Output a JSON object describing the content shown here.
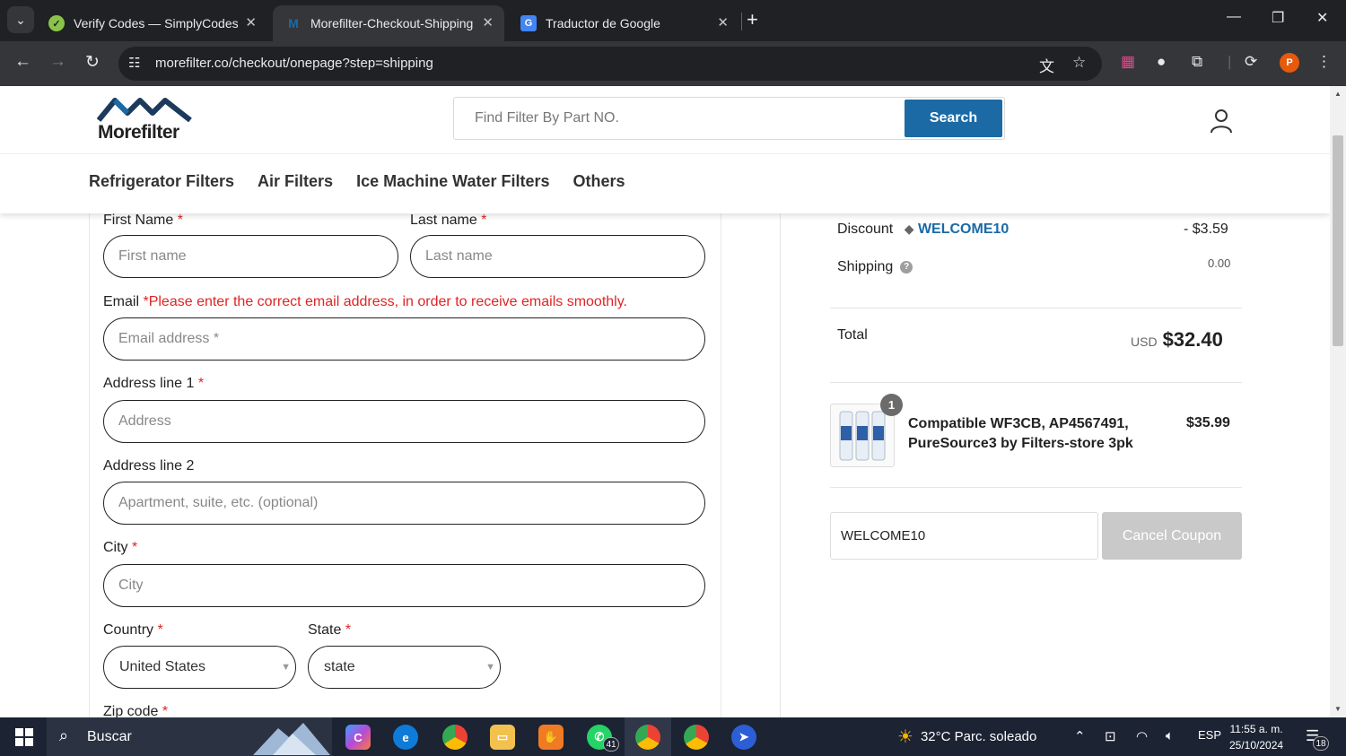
{
  "browser": {
    "tabs": [
      {
        "title": "Verify Codes — SimplyCodes",
        "active": false
      },
      {
        "title": "Morefilter-Checkout-Shipping",
        "active": true
      },
      {
        "title": "Traductor de Google",
        "active": false
      }
    ],
    "url": "morefilter.co/checkout/onepage?step=shipping",
    "profile_initial": "P"
  },
  "site": {
    "logo_text": "Morefilter",
    "search_placeholder": "Find Filter By Part NO.",
    "search_button": "Search",
    "nav": [
      "Refrigerator Filters",
      "Air Filters",
      "Ice Machine Water Filters",
      "Others"
    ]
  },
  "form": {
    "first_name": {
      "label": "First Name",
      "placeholder": "First name"
    },
    "last_name": {
      "label": "Last name",
      "placeholder": "Last name"
    },
    "email": {
      "label": "Email",
      "note": "*Please enter the correct email address, in order to receive emails smoothly.",
      "placeholder": "Email address *"
    },
    "address1": {
      "label": "Address line 1",
      "placeholder": "Address"
    },
    "address2": {
      "label": "Address line 2",
      "placeholder": "Apartment, suite, etc. (optional)"
    },
    "city": {
      "label": "City",
      "placeholder": "City"
    },
    "country": {
      "label": "Country",
      "value": "United States"
    },
    "state": {
      "label": "State",
      "value": "state"
    },
    "zip": {
      "label": "Zip code"
    },
    "required_mark": "*"
  },
  "summary": {
    "discount_label": "Discount",
    "coupon_code": "WELCOME10",
    "discount_value": "- $3.59",
    "shipping_label": "Shipping",
    "shipping_value": "0.00",
    "total_label": "Total",
    "currency": "USD",
    "total_value": "$32.40",
    "item": {
      "qty": "1",
      "name_line1": "Compatible WF3CB, AP4567491,",
      "name_line2": "PureSource3 by Filters-store 3pk",
      "price": "$35.99"
    },
    "coupon_input_value": "WELCOME10",
    "cancel_coupon": "Cancel Coupon"
  },
  "taskbar": {
    "search_text": "Buscar",
    "whatsapp_badge": "41",
    "weather": "32°C  Parc. soleado",
    "lang": "ESP",
    "time": "11:55 a. m.",
    "date": "25/10/2024",
    "notifications": "18"
  },
  "colors": {
    "brand_blue": "#1b6aa5",
    "required_red": "#e02424",
    "chrome_dark": "#202124"
  }
}
